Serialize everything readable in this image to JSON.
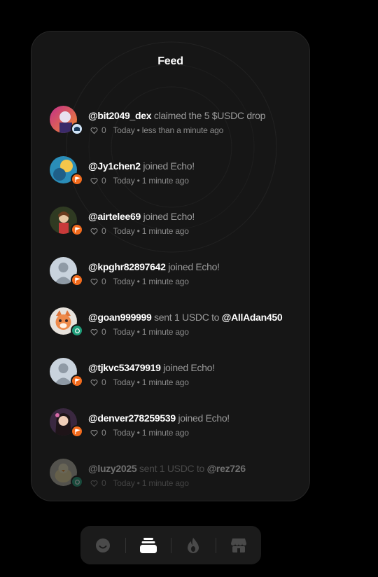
{
  "header": {
    "title": "Feed"
  },
  "feed": [
    {
      "user": "@bit2049_dex",
      "action": "claimed the 5 $USDC drop",
      "target": "",
      "likes": "0",
      "time": "Today • less than a minute ago",
      "badge": "wallet-badge",
      "avatar": "avatar-purple-art"
    },
    {
      "user": "@Jy1chen2",
      "action": "joined Echo!",
      "target": "",
      "likes": "0",
      "time": "Today • 1 minute ago",
      "badge": "flag-badge",
      "avatar": "avatar-blue-cartoon"
    },
    {
      "user": "@airtelee69",
      "action": "joined Echo!",
      "target": "",
      "likes": "0",
      "time": "Today • 1 minute ago",
      "badge": "flag-badge",
      "avatar": "avatar-doll"
    },
    {
      "user": "@kpghr82897642",
      "action": "joined Echo!",
      "target": "",
      "likes": "0",
      "time": "Today • 1 minute ago",
      "badge": "flag-badge",
      "avatar": "avatar-default"
    },
    {
      "user": "@goan999999",
      "action": "sent 1 USDC to",
      "target": "@AllAdan450",
      "likes": "0",
      "time": "Today • 1 minute ago",
      "badge": "send-badge",
      "avatar": "avatar-fox"
    },
    {
      "user": "@tjkvc53479919",
      "action": "joined Echo!",
      "target": "",
      "likes": "0",
      "time": "Today • 1 minute ago",
      "badge": "flag-badge",
      "avatar": "avatar-default"
    },
    {
      "user": "@denver278259539",
      "action": "joined Echo!",
      "target": "",
      "likes": "0",
      "time": "Today • 1 minute ago",
      "badge": "flag-badge",
      "avatar": "avatar-girl"
    },
    {
      "user": "@luzy2025",
      "action": "sent 1 USDC to",
      "target": "@rez726",
      "likes": "0",
      "time": "Today • 1 minute ago",
      "badge": "send-badge",
      "avatar": "avatar-duck"
    }
  ],
  "dock": [
    {
      "icon": "smiley-icon",
      "active": false
    },
    {
      "icon": "feed-stack-icon",
      "active": true
    },
    {
      "icon": "flame-icon",
      "active": false
    },
    {
      "icon": "store-icon",
      "active": false
    }
  ],
  "colors": {
    "background": "#000000",
    "card": "#161616",
    "flag_badge": "#f26b1d",
    "send_badge": "#1f9d7a",
    "wallet_badge": "#cfe3f7"
  }
}
